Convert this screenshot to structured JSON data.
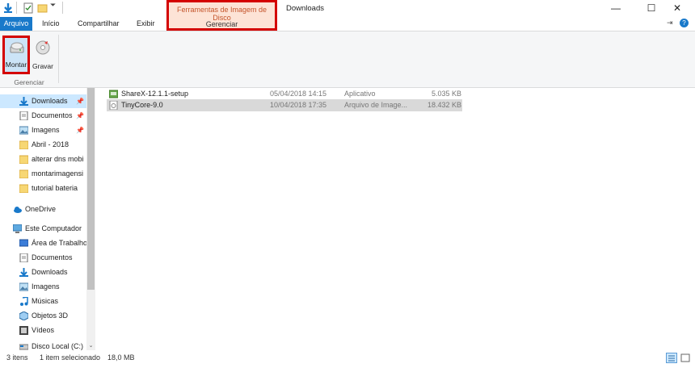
{
  "titlebar": {
    "context_title": "Ferramentas de Imagem de Disco",
    "context_tab": "Gerenciar",
    "window_title": "Downloads",
    "minimize": "—",
    "maximize": "☐",
    "close": "✕"
  },
  "tabs": [
    "Arquivo",
    "Início",
    "Compartilhar",
    "Exibir"
  ],
  "ribbon": {
    "montar_label": "Montar",
    "gravar_label": "Gravar",
    "group_label": "Gerenciar"
  },
  "nav": {
    "quick_access": [
      {
        "label": "Downloads",
        "icon": "download-arrow-icon",
        "pinned": true
      },
      {
        "label": "Documentos",
        "icon": "documents-icon",
        "pinned": true
      },
      {
        "label": "Imagens",
        "icon": "pictures-icon",
        "pinned": true
      },
      {
        "label": "Abril - 2018",
        "icon": "folder-icon",
        "pinned": false
      },
      {
        "label": "alterar dns mobi",
        "icon": "folder-icon",
        "pinned": false
      },
      {
        "label": "montarimagensi",
        "icon": "folder-icon",
        "pinned": false
      },
      {
        "label": "tutorial bateria",
        "icon": "folder-icon",
        "pinned": false
      }
    ],
    "onedrive": "OneDrive",
    "this_pc": "Este Computador",
    "pc_items": [
      {
        "label": "Área de Trabalho",
        "icon": "desktop-icon"
      },
      {
        "label": "Documentos",
        "icon": "documents-icon"
      },
      {
        "label": "Downloads",
        "icon": "download-arrow-icon"
      },
      {
        "label": "Imagens",
        "icon": "pictures-icon"
      },
      {
        "label": "Músicas",
        "icon": "music-icon"
      },
      {
        "label": "Objetos 3D",
        "icon": "3d-objects-icon"
      },
      {
        "label": "Vídeos",
        "icon": "videos-icon"
      },
      {
        "label": "Disco Local (C:)",
        "icon": "drive-icon"
      }
    ]
  },
  "files": [
    {
      "name": "ShareX-12.1.1-setup",
      "date": "05/04/2018 14:15",
      "type": "Aplicativo",
      "size": "5.035 KB",
      "selected": false
    },
    {
      "name": "TinyCore-9.0",
      "date": "10/04/2018 17:35",
      "type": "Arquivo de Image...",
      "size": "18.432 KB",
      "selected": true
    }
  ],
  "status": {
    "items": "3 itens",
    "selected": "1 item selecionado",
    "size": "18,0 MB"
  },
  "colors": {
    "accent": "#1979ca",
    "highlight_box": "#d40000",
    "context_tab_bg": "#fde3d6",
    "selection": "#d9d9d9"
  }
}
